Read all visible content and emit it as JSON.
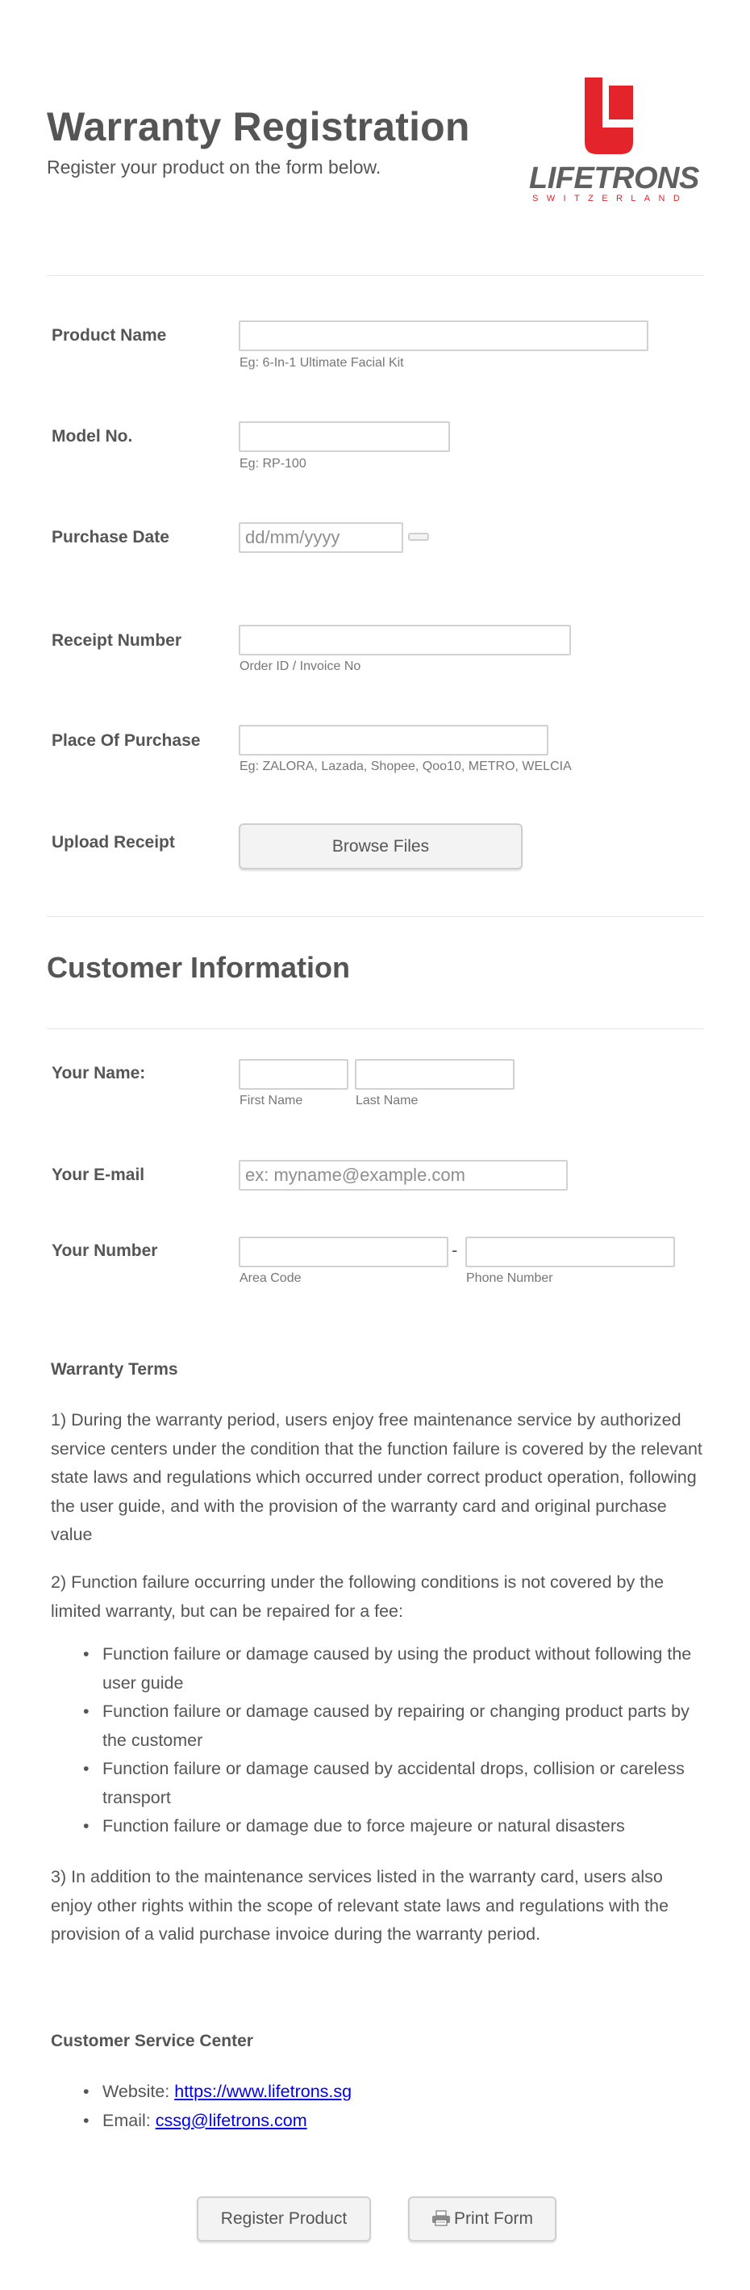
{
  "header": {
    "title": "Warranty Registration",
    "subtitle": "Register your product on the form below.",
    "logo": {
      "word": "LIFETRONS",
      "sub": "SWITZERLAND",
      "icon": "lifetrons-logo-icon",
      "brand_red": "#e3242b",
      "brand_gray": "#606060"
    }
  },
  "product": {
    "product_name": {
      "label": "Product Name",
      "value": "",
      "hint": "Eg: 6-In-1 Ultimate Facial Kit"
    },
    "model_no": {
      "label": "Model No.",
      "value": "",
      "hint": "Eg: RP-100"
    },
    "purchase_date": {
      "label": "Purchase Date",
      "value": "",
      "placeholder": "dd/mm/yyyy",
      "icon": "calendar-icon"
    },
    "receipt_number": {
      "label": "Receipt Number",
      "value": "",
      "hint": "Order ID / Invoice No"
    },
    "place_of_purchase": {
      "label": "Place Of Purchase",
      "value": "",
      "hint": "Eg: ZALORA, Lazada, Shopee, Qoo10, METRO, WELCIA"
    },
    "upload_receipt": {
      "label": "Upload Receipt",
      "button": "Browse Files"
    }
  },
  "customer": {
    "section_title": "Customer Information",
    "name": {
      "label": "Your Name:",
      "first_value": "",
      "first_hint": "First Name",
      "last_value": "",
      "last_hint": "Last Name"
    },
    "email": {
      "label": "Your E-mail",
      "value": "",
      "placeholder": "ex: myname@example.com"
    },
    "number": {
      "label": "Your Number",
      "separator": "-",
      "area_value": "",
      "area_hint": "Area Code",
      "phone_value": "",
      "phone_hint": "Phone Number"
    }
  },
  "terms": {
    "heading": "Warranty Terms",
    "p1": "1) During the warranty period, users enjoy free maintenance service by authorized service centers under the condition that the function failure is covered by the relevant state laws and regulations which occurred under correct product operation, following the user guide, and with the provision of the warranty card and original purchase value",
    "p2": "2) Function failure occurring under the following conditions is not covered by the limited warranty, but can be repaired for a fee:",
    "bullets": [
      "Function failure or damage caused by using the product without following the user guide",
      "Function failure or damage caused by repairing or changing product parts by the customer",
      "Function failure or damage caused by accidental drops, collision or careless transport",
      "Function failure or damage due to force majeure or natural disasters"
    ],
    "p3": "3) In addition to the maintenance services listed in the warranty card, users also enjoy other rights within the scope of relevant state laws and regulations with the provision of a valid purchase invoice during the warranty period."
  },
  "service_center": {
    "heading": "Customer Service Center",
    "website_label": "Website: ",
    "website": "https://www.lifetrons.sg",
    "email_label": "Email: ",
    "email": "cssg@lifetrons.com"
  },
  "actions": {
    "register": "Register Product",
    "print": "Print Form",
    "print_icon": "printer-icon"
  }
}
